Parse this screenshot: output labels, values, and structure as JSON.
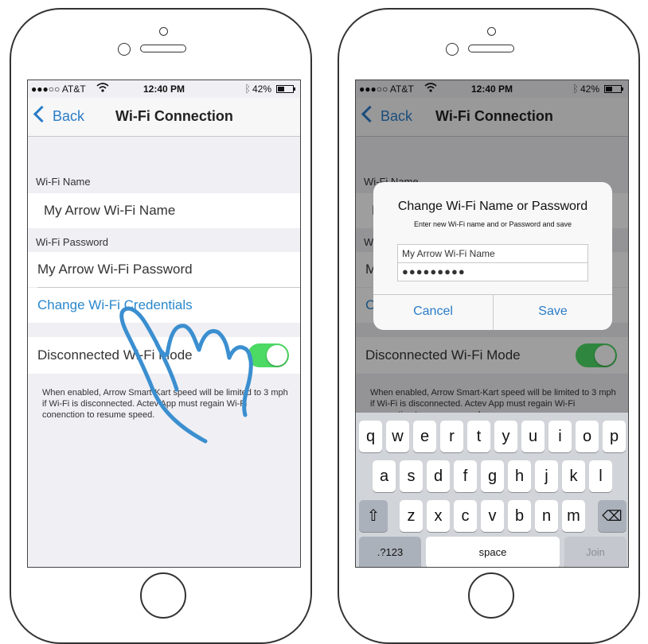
{
  "status_bar": {
    "carrier": "●●●○○ AT&T",
    "time": "12:40 PM",
    "battery": "42%"
  },
  "nav": {
    "back_label": "Back",
    "title": "Wi-Fi Connection"
  },
  "settings": {
    "wifi_name_label": "Wi-Fi Name",
    "wifi_name_value": "My Arrow Wi-Fi Name",
    "wifi_password_label": "Wi-Fi Password",
    "wifi_password_value": "My Arrow Wi-Fi Password",
    "change_credentials_label": "Change Wi-Fi Credentials",
    "disconnected_mode_label": "Disconnected Wi-Fi Mode",
    "disconnected_mode_on": true,
    "footnote": "When enabled, Arrow Smart-Kart speed will be limited to 3 mph if Wi-Fi is disconnected. Actev App must regain Wi-Fi conenction to resume speed."
  },
  "dialog": {
    "title": "Change Wi-Fi Name or Password",
    "message": "Enter new Wi-Fi name and or Password and save",
    "name_field_value": "My Arrow Wi-Fi Name",
    "password_field_value": "●●●●●●●●●",
    "cancel_label": "Cancel",
    "save_label": "Save"
  },
  "keyboard": {
    "row1": [
      "q",
      "w",
      "e",
      "r",
      "t",
      "y",
      "u",
      "i",
      "o",
      "p"
    ],
    "row2": [
      "a",
      "s",
      "d",
      "f",
      "g",
      "h",
      "j",
      "k",
      "l"
    ],
    "row3": [
      "z",
      "x",
      "c",
      "v",
      "b",
      "n",
      "m"
    ],
    "shift_icon": "⇧",
    "delete_icon": "⌫",
    "numbers_label": ".?123",
    "space_label": "space",
    "join_label": "Join"
  },
  "icons": {
    "wifi": "wifi-icon",
    "bluetooth": "bluetooth-icon",
    "battery": "battery-icon",
    "shift": "shift-icon",
    "delete": "delete-icon"
  },
  "colors": {
    "accent": "#2a7cc7",
    "toggle_on": "#4cd964",
    "gesture": "#3b8fd0"
  }
}
